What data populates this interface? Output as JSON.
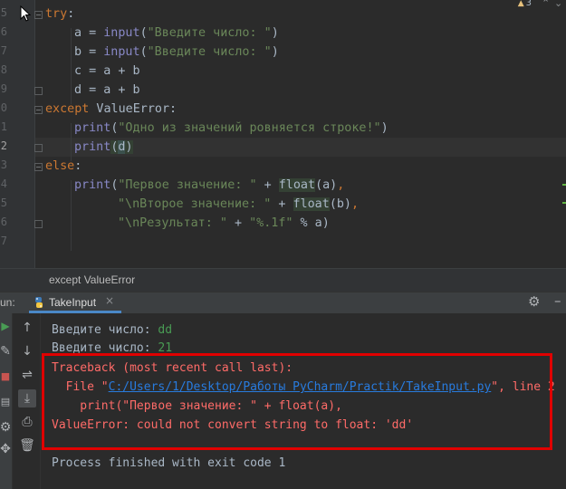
{
  "editor": {
    "line_numbers": [
      "5",
      "6",
      "7",
      "8",
      "9",
      "0",
      "1",
      "2",
      "3",
      "4",
      "5",
      "6",
      "7"
    ],
    "warning_count": "3",
    "code": {
      "l1": {
        "kw": "try",
        "p": ":"
      },
      "l2": {
        "a": "a = ",
        "fn": "input",
        "b": "(",
        "s": "\"Введите число: \"",
        "c": ")"
      },
      "l3": {
        "a": "b = ",
        "fn": "input",
        "b": "(",
        "s": "\"Введите число: \"",
        "c": ")"
      },
      "l4": {
        "a": "c = a + b"
      },
      "l5": {
        "a": "d = a + b"
      },
      "l6": {
        "kw": "except",
        "a": " ValueError:"
      },
      "l7": {
        "fn": "print",
        "b": "(",
        "s": "\"Одно из значений ровняется строке!\"",
        "c": ")"
      },
      "l8": {
        "fn": "print",
        "b": "(",
        "v": "d",
        "c": ")"
      },
      "l9": {
        "kw": "else",
        "p": ":"
      },
      "l10": {
        "fn": "print",
        "b": "(",
        "s": "\"Первое значение: \"",
        "op": " + ",
        "fn2": "float",
        "b2": "(a)",
        "c": ","
      },
      "l11": {
        "s": "\"\\nВторое значение: \"",
        "op": " + ",
        "fn2": "float",
        "b2": "(b)",
        "c": ","
      },
      "l12": {
        "s": "\"\\nРезультат: \"",
        "op": " + ",
        "s2": "\"%.1f\"",
        "op2": " % a)"
      }
    }
  },
  "breadcrumb": {
    "text": "except ValueError"
  },
  "run": {
    "label": "un:",
    "tab_name": "TakeInput",
    "close_glyph": "×"
  },
  "console": {
    "lines": {
      "l1": {
        "prompt": "Введите число: ",
        "input": "dd"
      },
      "l2": {
        "prompt": "Введите число: ",
        "input": "21"
      },
      "l3": {
        "text": "Traceback (most recent call last):"
      },
      "l4": {
        "pre": "  File \"",
        "link": "C:/Users/1/Desktop/Работы PyCharm/Practik/TakeInput.py",
        "post": "\", line 2"
      },
      "l5": {
        "text": "    print(\"Первое значение: \" + float(a),"
      },
      "l6": {
        "text": "ValueError: could not convert string to float: 'dd'"
      },
      "l7": {
        "text": "Process finished with exit code 1"
      }
    }
  },
  "colors": {
    "background": "#2b2b2b",
    "keyword": "#cc7832",
    "string": "#6a8759",
    "error": "#ff6b68",
    "link": "#287bde",
    "highlight_box": "#e00000"
  }
}
